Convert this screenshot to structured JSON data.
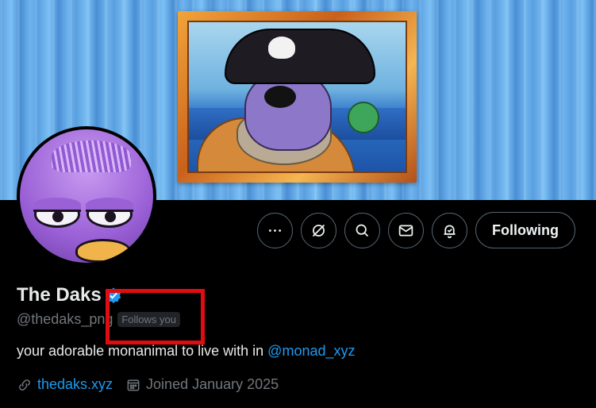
{
  "profile": {
    "name": "The Daks",
    "handle": "@thedaks_png",
    "follows_you": "Follows you",
    "bio_text": "your adorable monanimal to live with in ",
    "bio_mention": "@monad_xyz",
    "website": "thedaks.xyz",
    "joined": "Joined January 2025"
  },
  "actions": {
    "follow_label": "Following",
    "icons": [
      "more-icon",
      "grok-icon",
      "search-icon",
      "message-icon",
      "notification-icon"
    ]
  },
  "colors": {
    "accent": "#1d9bf0",
    "highlight": "#e10c12",
    "muted": "#71767b"
  }
}
